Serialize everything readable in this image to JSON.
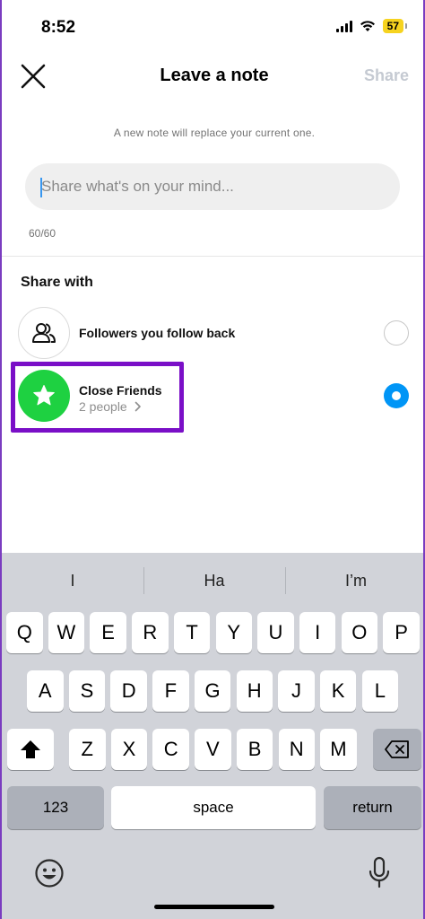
{
  "status_bar": {
    "time": "8:52",
    "battery": "57"
  },
  "header": {
    "title": "Leave a note",
    "share_label": "Share"
  },
  "note": {
    "info": "A new note will replace your current one.",
    "placeholder": "Share what's on your mind...",
    "counter": "60/60"
  },
  "share_with": {
    "title": "Share with",
    "options": [
      {
        "label": "Followers you follow back",
        "sub": "",
        "selected": false
      },
      {
        "label": "Close Friends",
        "sub": "2 people",
        "selected": true
      }
    ]
  },
  "keyboard": {
    "suggestions": [
      "I",
      "Ha",
      "I’m"
    ],
    "row1": [
      "Q",
      "W",
      "E",
      "R",
      "T",
      "Y",
      "U",
      "I",
      "O",
      "P"
    ],
    "row2": [
      "A",
      "S",
      "D",
      "F",
      "G",
      "H",
      "J",
      "K",
      "L"
    ],
    "row3": [
      "Z",
      "X",
      "C",
      "V",
      "B",
      "N",
      "M"
    ],
    "numbers_label": "123",
    "space_label": "space",
    "return_label": "return"
  },
  "colors": {
    "accent_blue": "#0095f6",
    "close_friends_green": "#1ed141",
    "highlight_purple": "#7a0fc7"
  }
}
